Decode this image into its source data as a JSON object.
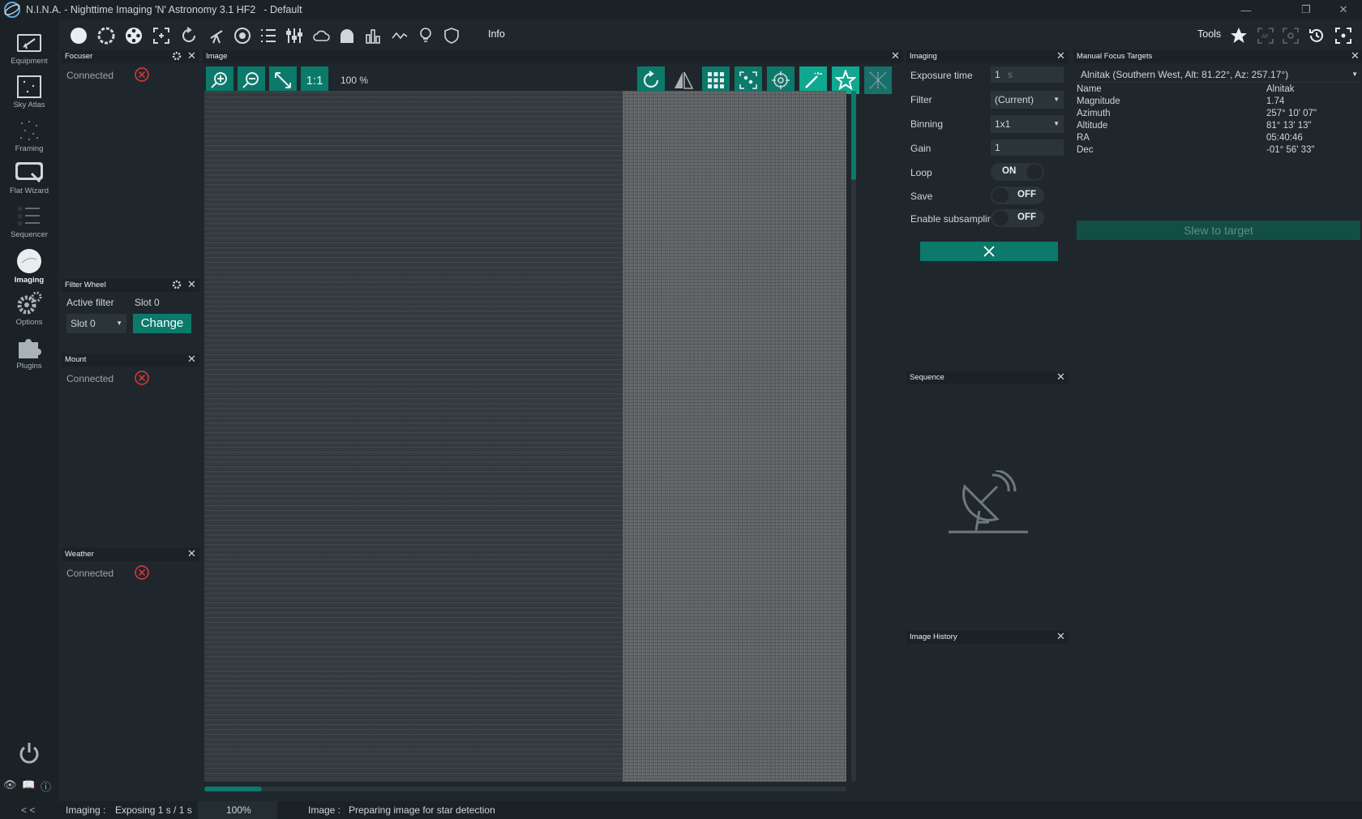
{
  "window": {
    "title": "N.I.N.A. - Nighttime Imaging 'N' Astronomy 3.1 HF2",
    "profile": "-  Default"
  },
  "nav": [
    {
      "label": "Equipment",
      "icon": "telescope-icon"
    },
    {
      "label": "Sky Atlas",
      "icon": "sky-atlas-icon"
    },
    {
      "label": "Framing",
      "icon": "framing-icon"
    },
    {
      "label": "Flat Wizard",
      "icon": "flat-wizard-icon"
    },
    {
      "label": "Sequencer",
      "icon": "sequencer-icon"
    },
    {
      "label": "Imaging",
      "icon": "imaging-icon",
      "active": true
    },
    {
      "label": "Options",
      "icon": "gear-icon"
    },
    {
      "label": "Plugins",
      "icon": "puzzle-icon"
    }
  ],
  "toolbar": {
    "info_label": "Info",
    "tools_label": "Tools"
  },
  "focuser": {
    "title": "Focuser",
    "connected_label": "Connected"
  },
  "filterwheel": {
    "title": "Filter Wheel",
    "active_filter_label": "Active filter",
    "active_filter_value": "Slot 0",
    "select_value": "Slot 0",
    "change_label": "Change"
  },
  "mount": {
    "title": "Mount",
    "connected_label": "Connected"
  },
  "weather": {
    "title": "Weather",
    "connected_label": "Connected"
  },
  "image": {
    "title": "Image",
    "one_to_one": "1:1",
    "zoom": "100 %",
    "progress": 0.09
  },
  "imaging": {
    "title": "Imaging",
    "exposure_label": "Exposure time",
    "exposure_value": "1",
    "exposure_unit": "s",
    "filter_label": "Filter",
    "filter_value": "(Current)",
    "binning_label": "Binning",
    "binning_value": "1x1",
    "gain_label": "Gain",
    "gain_value": "1",
    "loop_label": "Loop",
    "loop_value": "ON",
    "save_label": "Save",
    "save_value": "OFF",
    "subsample_label": "Enable subsamplir",
    "subsample_value": "OFF"
  },
  "sequence": {
    "title": "Sequence"
  },
  "history": {
    "title": "Image History"
  },
  "focus_targets": {
    "title": "Manual Focus Targets",
    "selected": "Alnitak (Southern West, Alt: 81.22°, Az: 257.17°)",
    "rows": [
      {
        "label": "Name",
        "value": "Alnitak"
      },
      {
        "label": "Magnitude",
        "value": "1.74"
      },
      {
        "label": "Azimuth",
        "value": "257° 10' 07\""
      },
      {
        "label": "Altitude",
        "value": "81° 13' 13\""
      },
      {
        "label": "RA",
        "value": "05:40:46"
      },
      {
        "label": "Dec",
        "value": "-01° 56' 33\""
      }
    ],
    "slew_label": "Slew to target"
  },
  "status": {
    "collapse": "< <",
    "imaging_label": "Imaging :",
    "imaging_value": "Exposing 1 s / 1 s",
    "percent": "100%",
    "image_label": "Image :",
    "image_value": "Preparing image for star detection"
  },
  "colors": {
    "accent": "#0b7a6b",
    "background": "#1f272c",
    "header": "#1a2226",
    "error": "#e0393e"
  }
}
